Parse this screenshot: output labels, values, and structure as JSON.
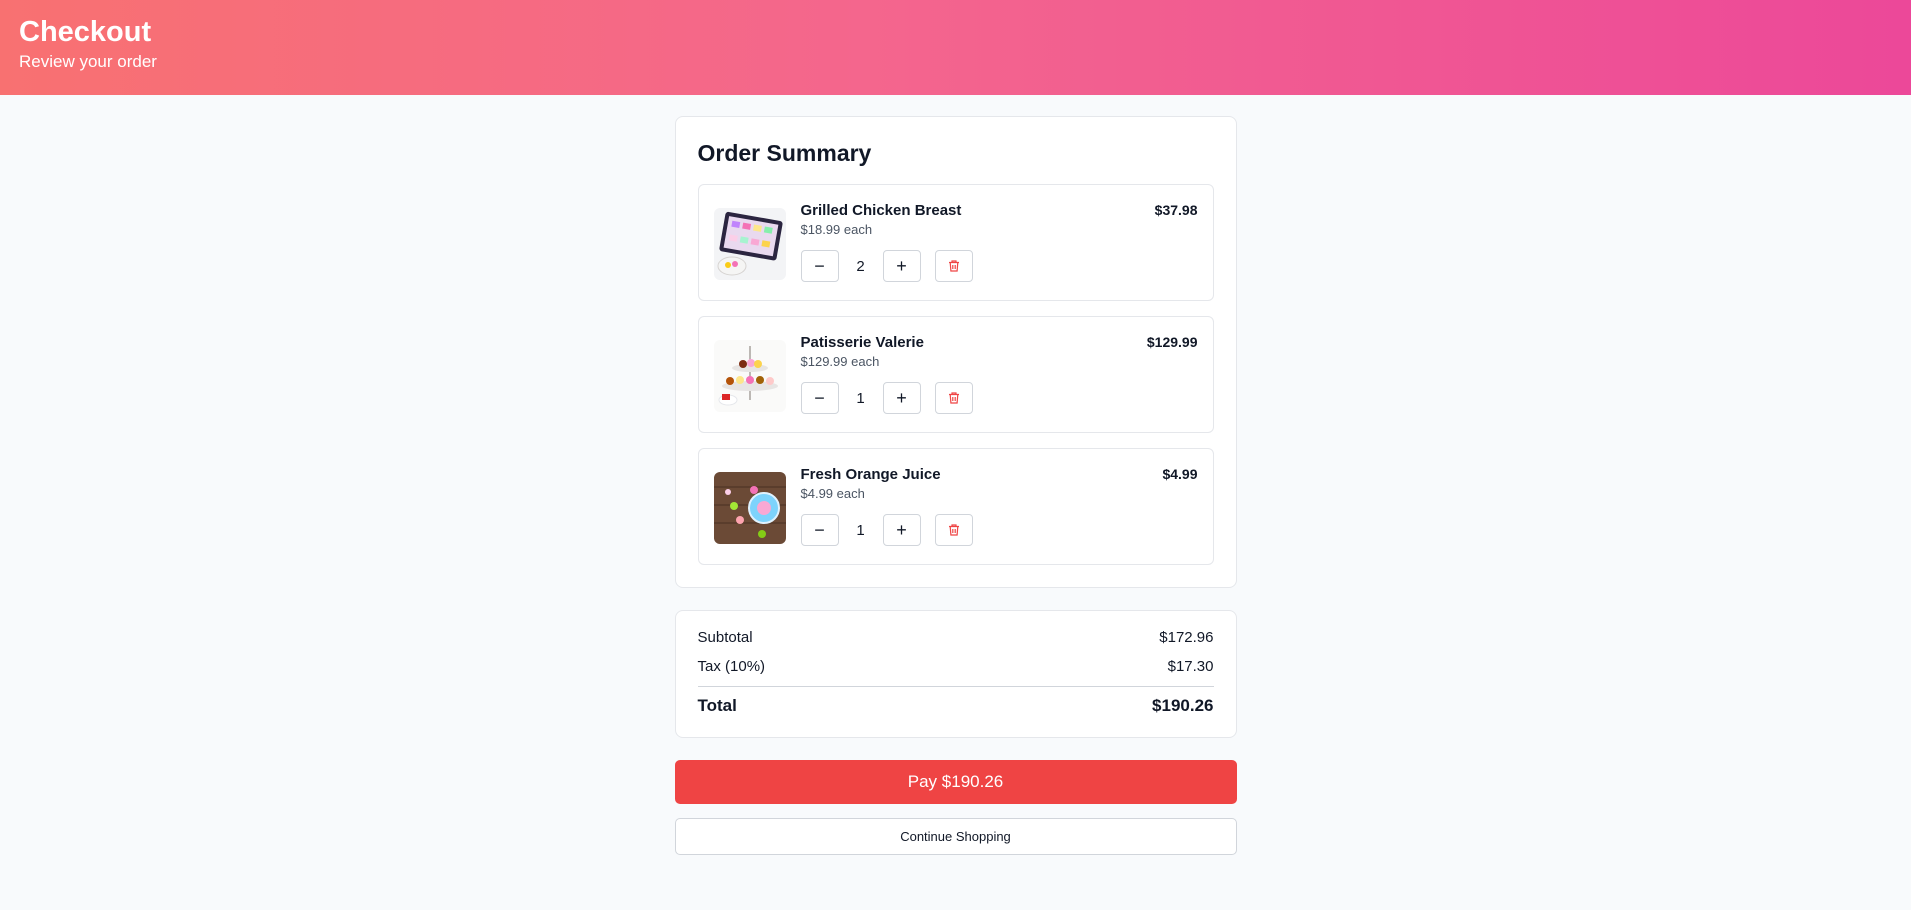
{
  "header": {
    "title": "Checkout",
    "subtitle": "Review your order"
  },
  "summary": {
    "title": "Order Summary",
    "items": [
      {
        "name": "Grilled Chicken Breast",
        "each": "$18.99 each",
        "qty": "2",
        "total": "$37.98",
        "image": "chocolate-box-image"
      },
      {
        "name": "Patisserie Valerie",
        "each": "$129.99 each",
        "qty": "1",
        "total": "$129.99",
        "image": "cake-stand-image"
      },
      {
        "name": "Fresh Orange Juice",
        "each": "$4.99 each",
        "qty": "1",
        "total": "$4.99",
        "image": "macarons-table-image"
      }
    ],
    "icons": {
      "decrease": "minus-icon",
      "increase": "plus-icon",
      "remove": "trash-icon"
    },
    "decrease_symbol": "−",
    "increase_symbol": "+"
  },
  "totals": {
    "subtotal_label": "Subtotal",
    "subtotal": "$172.96",
    "tax_label": "Tax (10%)",
    "tax": "$17.30",
    "total_label": "Total",
    "total": "$190.26"
  },
  "actions": {
    "pay_label": "Pay $190.26",
    "continue_label": "Continue Shopping"
  },
  "colors": {
    "accent": "#ef4444",
    "header_start": "#f87171",
    "header_end": "#ec4899"
  }
}
